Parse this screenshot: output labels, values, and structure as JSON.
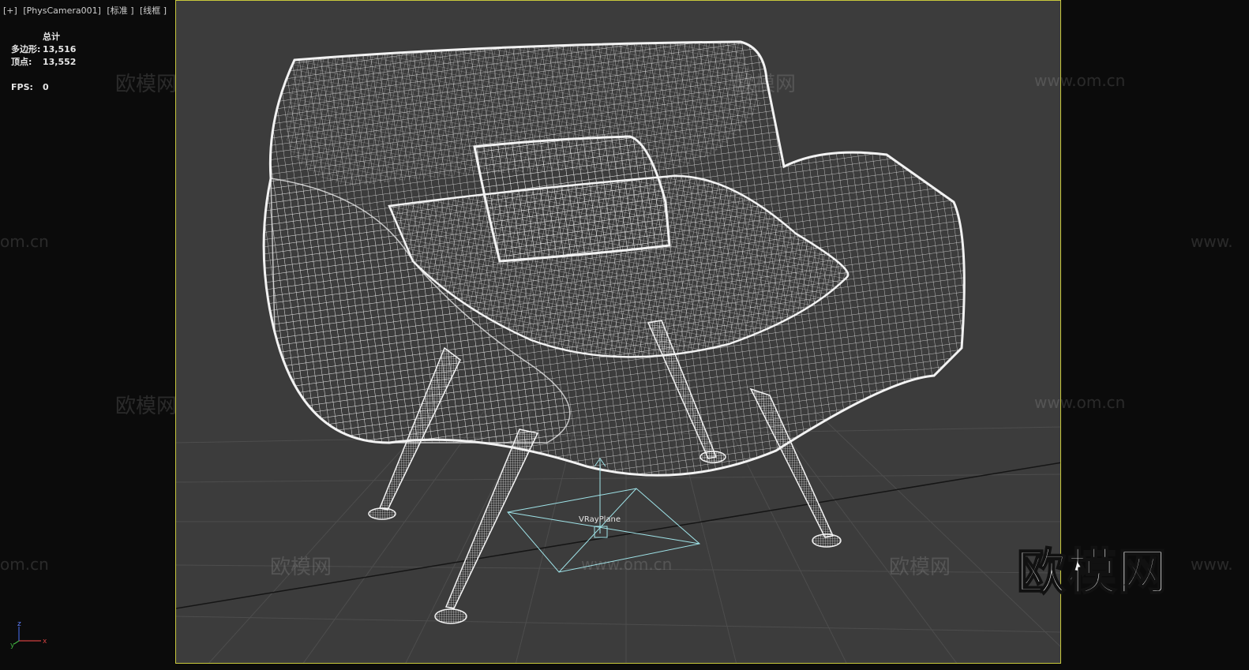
{
  "viewport": {
    "labels": [
      "[+]",
      "[PhysCamera001]",
      "[标准 ]",
      "[线框 ]"
    ]
  },
  "stats": {
    "title": "总计",
    "rows": [
      {
        "label": "多边形:",
        "value": "13,516"
      },
      {
        "label": "顶点:",
        "value": "13,552"
      }
    ],
    "fps_label": "FPS:",
    "fps_value": "0"
  },
  "scene": {
    "object_label": "VRayPlane"
  },
  "watermarks": {
    "cn": "欧模网",
    "url": "www.om.cn",
    "url_partial": "om.cn",
    "url_cut": "www.",
    "brand": "欧模网"
  },
  "axis": {
    "x": "x",
    "z": "z",
    "y": "y"
  },
  "colors": {
    "viewport_bg": "#3c3c3c",
    "frame_border": "#c8c83c",
    "wireframe": "#e8e8e8",
    "gizmo": "#9fe3e8"
  }
}
